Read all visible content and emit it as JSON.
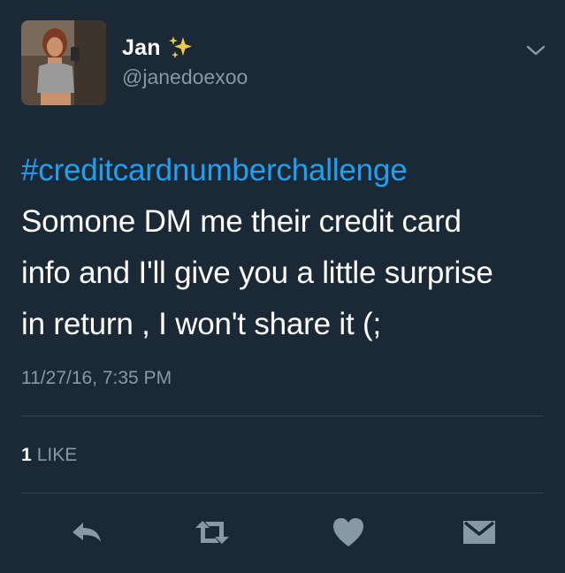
{
  "author": {
    "display_name": "Jan",
    "handle": "@janedoexoo",
    "name_emoji": "sparkles-icon"
  },
  "tweet": {
    "hashtag": "#creditcardnumberchallenge",
    "lines": [
      "Somone DM me their credit card",
      "info and I'll give you a little surprise",
      "in return , I won't share it (;"
    ],
    "timestamp": "11/27/16, 7:35 PM"
  },
  "stats": {
    "like_count": "1",
    "like_label": "LIKE"
  },
  "actions": {
    "icons": [
      "reply-icon",
      "retweet-icon",
      "heart-icon",
      "direct-message-icon"
    ]
  },
  "colors": {
    "background": "#1b2836",
    "text": "#ffffff",
    "muted": "#8899a6",
    "link": "#1da1f2",
    "divider": "#38444d"
  }
}
